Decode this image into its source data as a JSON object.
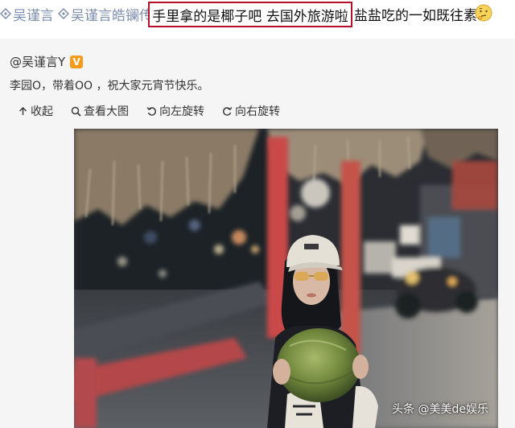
{
  "topbar": {
    "tags": [
      {
        "label": "吴谨言",
        "icon": "hashtag-icon"
      },
      {
        "label": "吴谨言皓镧传",
        "icon": "hashtag-icon"
      }
    ],
    "highlight_text": "手里拿的是椰子吧 去国外旅游啦",
    "after_text": "盐盐吃的一如既往素",
    "emoji": "thinking-face-icon",
    "highlight_border_color": "#b3102a"
  },
  "post": {
    "username": "@吴谨言Y",
    "verified_badge": "V",
    "text": "李园O，带着OO ，祝大家元宵节快乐。",
    "actions": [
      {
        "label": "收起",
        "icon": "collapse-icon"
      },
      {
        "label": "查看大图",
        "icon": "search-icon"
      },
      {
        "label": "向左旋转",
        "icon": "rotate-left-icon"
      },
      {
        "label": "向右旋转",
        "icon": "rotate-right-icon"
      }
    ]
  },
  "photo": {
    "watermark": "头条 @美美de娱乐"
  }
}
